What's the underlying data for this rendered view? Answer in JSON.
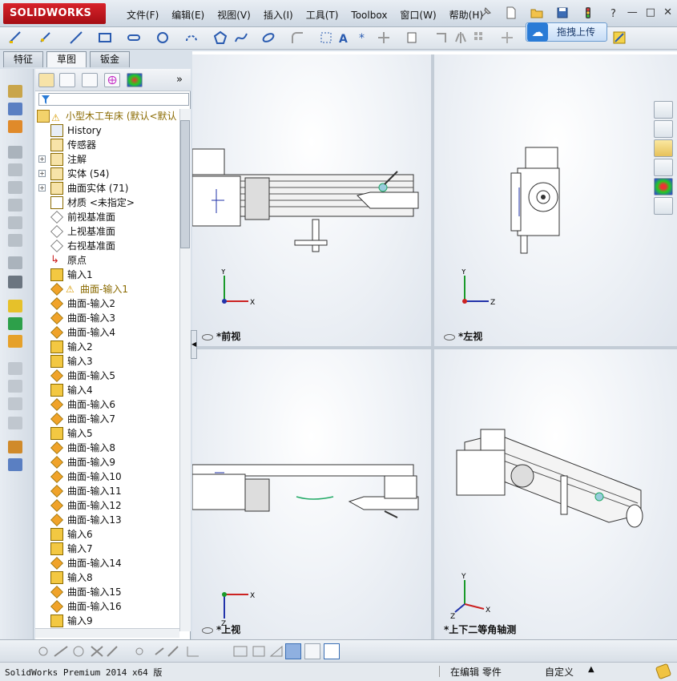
{
  "app": {
    "logo_text": "SOLIDWORKS"
  },
  "menu": [
    "文件(F)",
    "编辑(E)",
    "视图(V)",
    "插入(I)",
    "工具(T)",
    "Toolbox",
    "窗口(W)",
    "帮助(H)"
  ],
  "upload_button": {
    "label": "拖拽上传"
  },
  "tabs": [
    "特征",
    "草图",
    "钣金"
  ],
  "tree": {
    "root": "小型木工车床  (默认<默认",
    "items": [
      {
        "label": "History",
        "icon": "history-icon",
        "expandable": false
      },
      {
        "label": "传感器",
        "icon": "sensor-icon",
        "expandable": false
      },
      {
        "label": "注解",
        "icon": "annotation-icon",
        "expandable": true
      },
      {
        "label": "实体 (54)",
        "icon": "solid-body-icon",
        "expandable": true
      },
      {
        "label": "曲面实体 (71)",
        "icon": "surface-body-icon",
        "expandable": true
      },
      {
        "label": "材质 <未指定>",
        "icon": "material-icon",
        "expandable": false
      },
      {
        "label": "前视基准面",
        "icon": "plane-icon",
        "expandable": false
      },
      {
        "label": "上视基准面",
        "icon": "plane-icon",
        "expandable": false
      },
      {
        "label": "右视基准面",
        "icon": "plane-icon",
        "expandable": false
      },
      {
        "label": "原点",
        "icon": "origin-icon",
        "expandable": false
      },
      {
        "label": "输入1",
        "icon": "import-icon",
        "expandable": false
      },
      {
        "label": "曲面-输入1",
        "icon": "surface-import-icon",
        "expandable": false,
        "warning": true
      },
      {
        "label": "曲面-输入2",
        "icon": "surface-import-icon",
        "expandable": false
      },
      {
        "label": "曲面-输入3",
        "icon": "surface-import-icon",
        "expandable": false
      },
      {
        "label": "曲面-输入4",
        "icon": "surface-import-icon",
        "expandable": false
      },
      {
        "label": "输入2",
        "icon": "import-icon",
        "expandable": false
      },
      {
        "label": "输入3",
        "icon": "import-icon",
        "expandable": false
      },
      {
        "label": "曲面-输入5",
        "icon": "surface-import-icon",
        "expandable": false
      },
      {
        "label": "输入4",
        "icon": "import-icon",
        "expandable": false
      },
      {
        "label": "曲面-输入6",
        "icon": "surface-import-icon",
        "expandable": false
      },
      {
        "label": "曲面-输入7",
        "icon": "surface-import-icon",
        "expandable": false
      },
      {
        "label": "输入5",
        "icon": "import-icon",
        "expandable": false
      },
      {
        "label": "曲面-输入8",
        "icon": "surface-import-icon",
        "expandable": false
      },
      {
        "label": "曲面-输入9",
        "icon": "surface-import-icon",
        "expandable": false
      },
      {
        "label": "曲面-输入10",
        "icon": "surface-import-icon",
        "expandable": false
      },
      {
        "label": "曲面-输入11",
        "icon": "surface-import-icon",
        "expandable": false
      },
      {
        "label": "曲面-输入12",
        "icon": "surface-import-icon",
        "expandable": false
      },
      {
        "label": "曲面-输入13",
        "icon": "surface-import-icon",
        "expandable": false
      },
      {
        "label": "输入6",
        "icon": "import-icon",
        "expandable": false
      },
      {
        "label": "输入7",
        "icon": "import-icon",
        "expandable": false
      },
      {
        "label": "曲面-输入14",
        "icon": "surface-import-icon",
        "expandable": false
      },
      {
        "label": "输入8",
        "icon": "import-icon",
        "expandable": false
      },
      {
        "label": "曲面-输入15",
        "icon": "surface-import-icon",
        "expandable": false
      },
      {
        "label": "曲面-输入16",
        "icon": "surface-import-icon",
        "expandable": false
      },
      {
        "label": "输入9",
        "icon": "import-icon",
        "expandable": false
      }
    ]
  },
  "viewports": [
    {
      "name": "*前视",
      "axes": [
        "Y",
        "X"
      ]
    },
    {
      "name": "*左视",
      "axes": [
        "Y",
        "Z"
      ]
    },
    {
      "name": "*上视",
      "axes": [
        "X",
        "Z"
      ]
    },
    {
      "name": "*上下二等角轴测",
      "axes": [
        "Y",
        "X",
        "Z"
      ]
    }
  ],
  "status": {
    "version": "SolidWorks Premium 2014 x64 版",
    "mode": "在编辑 零件",
    "units": "自定义"
  },
  "colors": {
    "accent": "#2a7bd6",
    "warning": "#e8a400",
    "brand": "#c8191f"
  }
}
